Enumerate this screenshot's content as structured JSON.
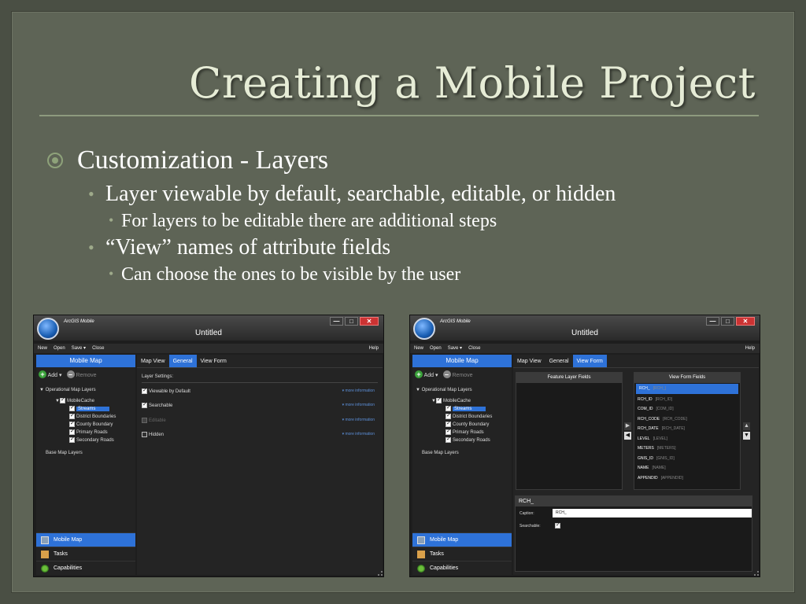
{
  "slide": {
    "title": "Creating a Mobile Project",
    "bullets": {
      "l1": "Customization - Layers",
      "l2a": "Layer viewable by default, searchable, editable, or hidden",
      "l3a": "For layers to be editable there are additional steps",
      "l2b": "“View” names of attribute fields",
      "l3b": "Can choose the ones to be visible by the user"
    }
  },
  "app": {
    "name": "ArcGIS Mobile",
    "doc_title": "Untitled",
    "menu": {
      "new": "New",
      "open": "Open",
      "save": "Save",
      "close": "Close",
      "help": "Help"
    },
    "controls": {
      "minimize": "—",
      "maximize": "□",
      "close": "✕"
    },
    "sidebar": {
      "header": "Mobile Map",
      "add": "Add",
      "remove": "Remove",
      "tree": {
        "operational": "Operational Map Layers",
        "cache": "MobileCache",
        "layers": [
          "Streams",
          "District Boundaries",
          "County Boundary",
          "Primary Roads",
          "Secondary Roads"
        ],
        "base": "Base Map Layers"
      },
      "nav": [
        "Mobile Map",
        "Tasks",
        "Capabilities"
      ]
    },
    "tabs": [
      "Map View",
      "General",
      "View Form"
    ],
    "general": {
      "settings_title": "Layer Settings:",
      "options": [
        {
          "label": "Viewable by Default",
          "more": "▾ more information"
        },
        {
          "label": "Searchable",
          "more": "▾ more information"
        },
        {
          "label": "Editable",
          "more": "▾ more information"
        },
        {
          "label": "Hidden",
          "more": "▾ more information"
        }
      ]
    },
    "viewform": {
      "feature_header": "Feature Layer Fields",
      "view_header": "View Form Fields",
      "fields": [
        {
          "name": "RCH_",
          "alias": "[RCH_]"
        },
        {
          "name": "RCH_ID",
          "alias": "[RCH_ID]"
        },
        {
          "name": "COM_ID",
          "alias": "[COM_ID]"
        },
        {
          "name": "RCH_CODE",
          "alias": "[RCH_CODE]"
        },
        {
          "name": "RCH_DATE",
          "alias": "[RCH_DATE]"
        },
        {
          "name": "LEVEL",
          "alias": "[LEVEL]"
        },
        {
          "name": "METERS",
          "alias": "[METERS]"
        },
        {
          "name": "GNIS_ID",
          "alias": "[GNIS_ID]"
        },
        {
          "name": "NAME",
          "alias": "[NAME]"
        },
        {
          "name": "APPENDID",
          "alias": "[APPENDID]"
        }
      ],
      "detail_header": "RCH_",
      "caption_label": "Caption:",
      "caption_value": "RCH_",
      "searchable_label": "Searchable:"
    }
  }
}
